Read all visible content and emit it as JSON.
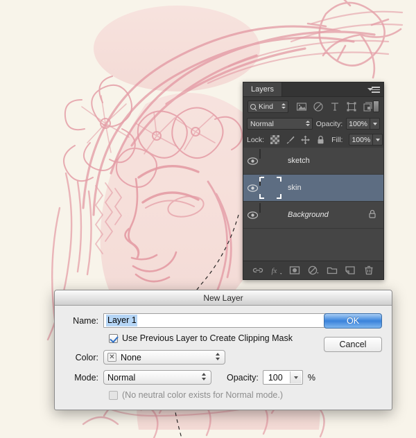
{
  "artwork": {
    "description": "pink sketch of girl with flower crown",
    "background_color": "#f8f4ea",
    "ink_color": "#e08f9b"
  },
  "layers_panel": {
    "tab_label": "Layers",
    "menu_icon": "panel-menu-icon",
    "filter": {
      "kind_label": "Kind",
      "search_icon": "magnifier-icon",
      "icons": [
        "pixel-filter-icon",
        "adjustment-filter-icon",
        "type-filter-icon",
        "shape-filter-icon",
        "smart-object-filter-icon"
      ],
      "toggle": "filter-enable-toggle"
    },
    "blend_mode": "Normal",
    "opacity_label": "Opacity:",
    "opacity_value": "100%",
    "lock_label": "Lock:",
    "lock_icons": [
      "lock-transparency-icon",
      "lock-image-icon",
      "lock-position-icon",
      "lock-all-icon"
    ],
    "fill_label": "Fill:",
    "fill_value": "100%",
    "layers": [
      {
        "name": "sketch",
        "visible": true,
        "selected": false,
        "locked": false,
        "italic": false
      },
      {
        "name": "skin",
        "visible": true,
        "selected": true,
        "locked": false,
        "italic": false
      },
      {
        "name": "Background",
        "visible": true,
        "selected": false,
        "locked": true,
        "italic": true
      }
    ],
    "footer_icons": [
      "link-layers-icon",
      "fx-icon",
      "add-mask-icon",
      "adjustment-layer-icon",
      "new-group-icon",
      "new-layer-icon",
      "delete-layer-icon"
    ],
    "footer_labels": {
      "fx": "fx"
    }
  },
  "dialog": {
    "title": "New Layer",
    "name_label": "Name:",
    "name_value": "Layer 1",
    "ok_label": "OK",
    "cancel_label": "Cancel",
    "clipping_checkbox": {
      "label": "Use Previous Layer to Create Clipping Mask",
      "checked": true
    },
    "color_label": "Color:",
    "color_value": "None",
    "color_swatch_glyph": "✕",
    "mode_label": "Mode:",
    "mode_value": "Normal",
    "opacity_label": "Opacity:",
    "opacity_value": "100",
    "percent_symbol": "%",
    "neutral_checkbox": {
      "label": "(No neutral color exists for Normal mode.)",
      "checked": false,
      "disabled": true
    }
  },
  "colors": {
    "panel_bg": "#3c3c3c",
    "layer_list_bg": "#454545",
    "selected_layer": "#5d6d82",
    "dialog_bg": "#ececec",
    "ok_button": "#3c83db",
    "text_selection": "#b5d5f5"
  }
}
